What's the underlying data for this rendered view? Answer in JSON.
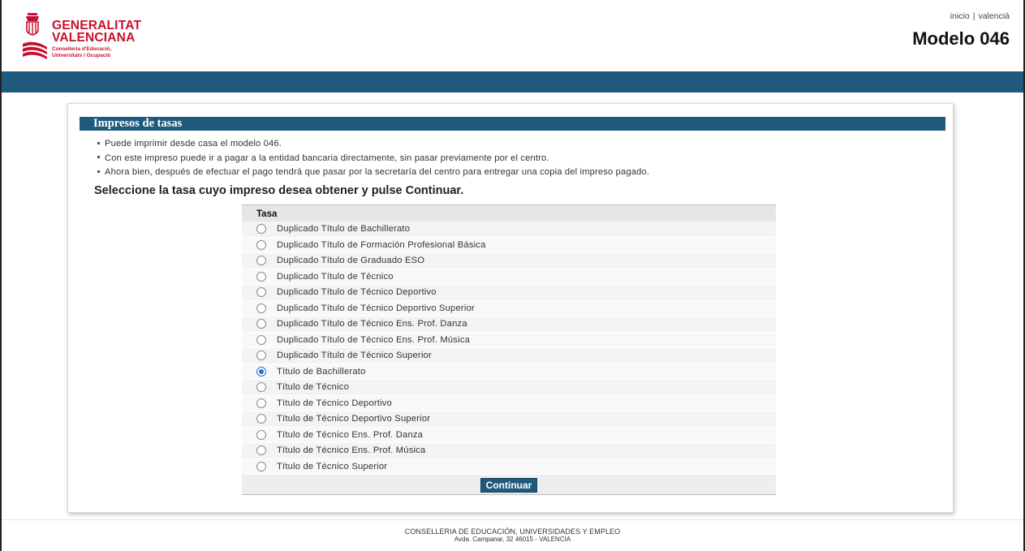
{
  "header": {
    "logo_line1": "GENERALITAT",
    "logo_line2": "VALENCIANA",
    "logo_sub1": "Conselleria d'Educació,",
    "logo_sub2": "Universitats i Ocupació",
    "links": {
      "home": "inicio",
      "separator": "|",
      "language": "valenciá"
    },
    "title": "Modelo 046"
  },
  "panel": {
    "heading": "Impresos de tasas",
    "bullets": [
      "Puede imprimir desde casa el modelo 046.",
      "Con este impreso puede ir a pagar a la entidad bancaria directamente, sin pasar previamente por el centro.",
      "Ahora bien, después de efectuar el pago tendrá que pasar por la secretaría del centro para entregar una copia del impreso pagado."
    ],
    "instruction": "Seleccione la tasa cuyo impreso desea obtener y pulse Continuar.",
    "table": {
      "header": "Tasa",
      "options": [
        {
          "label": "Duplicado Título de Bachillerato",
          "checked": false
        },
        {
          "label": "Duplicado Título de Formación Profesional Básica",
          "checked": false
        },
        {
          "label": "Duplicado Título de Graduado ESO",
          "checked": false
        },
        {
          "label": "Duplicado Título de Técnico",
          "checked": false
        },
        {
          "label": "Duplicado Título de Técnico Deportivo",
          "checked": false
        },
        {
          "label": "Duplicado Título de Técnico Deportivo Superior",
          "checked": false
        },
        {
          "label": "Duplicado Título de Técnico Ens. Prof. Danza",
          "checked": false
        },
        {
          "label": "Duplicado Título de Técnico Ens. Prof. Música",
          "checked": false
        },
        {
          "label": "Duplicado Título de Técnico Superior",
          "checked": false
        },
        {
          "label": "Título de Bachillerato",
          "checked": true
        },
        {
          "label": "Título de Técnico",
          "checked": false
        },
        {
          "label": "Título de Técnico Deportivo",
          "checked": false
        },
        {
          "label": "Título de Técnico Deportivo Superior",
          "checked": false
        },
        {
          "label": "Título de Técnico Ens. Prof. Danza",
          "checked": false
        },
        {
          "label": "Título de Técnico Ens. Prof. Música",
          "checked": false
        },
        {
          "label": "Título de Técnico Superior",
          "checked": false
        }
      ],
      "continue_label": "Continuar"
    }
  },
  "footer": {
    "line1": "CONSELLERIA DE EDUCACIÓN, UNIVERSIDADES Y EMPLEO",
    "line2": "Avda. Campanar, 32 46015 - VALENCIA"
  },
  "colors": {
    "brand_red": "#c8102e",
    "bar_blue": "#1f5a7d",
    "radio_selected": "#2a6fd6"
  }
}
